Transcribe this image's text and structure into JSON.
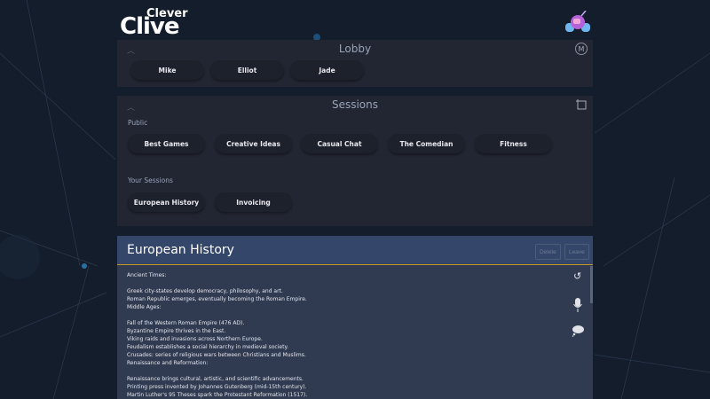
{
  "logo": {
    "top": "Clever",
    "bottom": "Clive"
  },
  "lobby": {
    "title": "Lobby",
    "user_initial": "M",
    "members": [
      "Mike",
      "Elliot",
      "Jade"
    ]
  },
  "sessions": {
    "title": "Sessions",
    "public_label": "Public",
    "public": [
      "Best Games",
      "Creative Ideas",
      "Casual Chat",
      "The Comedian",
      "Fitness"
    ],
    "yours_label": "Your Sessions",
    "yours": [
      "European History",
      "Invoicing"
    ]
  },
  "session": {
    "title": "European History",
    "delete_label": "Delete",
    "leave_label": "Leave",
    "lines": [
      "Ancient Times:",
      "",
      "Greek city-states develop democracy, philosophy, and art.",
      "Roman Republic emerges, eventually becoming the Roman Empire.",
      "Middle Ages:",
      "",
      "Fall of the Western Roman Empire (476 AD).",
      "Byzantine Empire thrives in the East.",
      "Viking raids and invasions across Northern Europe.",
      "Feudalism establishes a social hierarchy in medieval society.",
      "Crusades: series of religious wars between Christians and Muslims.",
      "Renaissance and Reformation:",
      "",
      "Renaissance brings cultural, artistic, and scientific advancements.",
      "Printing press invented by Johannes Gutenberg (mid-15th century).",
      "Martin Luther's 95 Theses spark the Protestant Reformation (1517)."
    ]
  }
}
